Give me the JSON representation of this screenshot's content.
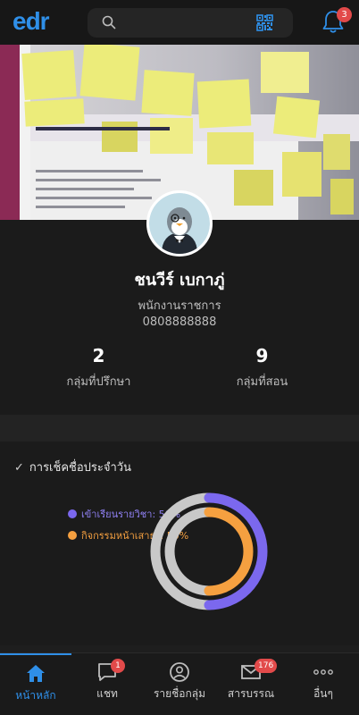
{
  "header": {
    "logo": "edr",
    "search_placeholder": "",
    "notifications_count": "3"
  },
  "profile": {
    "name": "ชนวีร์ เบกาภู่",
    "position": "พนักงานราชการ",
    "phone": "0808888888",
    "stats": [
      {
        "value": "2",
        "label": "กลุ่มที่ปรึกษา"
      },
      {
        "value": "9",
        "label": "กลุ่มที่สอน"
      }
    ]
  },
  "attendance": {
    "title": "การเช็คชื่อประจำวัน",
    "items": [
      {
        "label": "เข้าเรียนรายวิชา: 50%",
        "color": "#7b68ee",
        "percent": 50
      },
      {
        "label": "กิจกรรมหน้าเสาธง: 50%",
        "color": "#f5a040",
        "percent": 50
      }
    ],
    "track_color": "#c8c8c8"
  },
  "nav": {
    "items": [
      {
        "label": "หน้าหลัก",
        "icon": "home-icon",
        "active": true,
        "badge": ""
      },
      {
        "label": "แชท",
        "icon": "chat-icon",
        "active": false,
        "badge": "1"
      },
      {
        "label": "รายชื่อกลุ่ม",
        "icon": "group-icon",
        "active": false,
        "badge": ""
      },
      {
        "label": "สารบรรณ",
        "icon": "mail-icon",
        "active": false,
        "badge": "176"
      },
      {
        "label": "อื่นๆ",
        "icon": "more-icon",
        "active": false,
        "badge": ""
      }
    ]
  },
  "colors": {
    "accent": "#2f8fe8",
    "badge": "#e24a4a",
    "background": "#1b1b1b"
  }
}
